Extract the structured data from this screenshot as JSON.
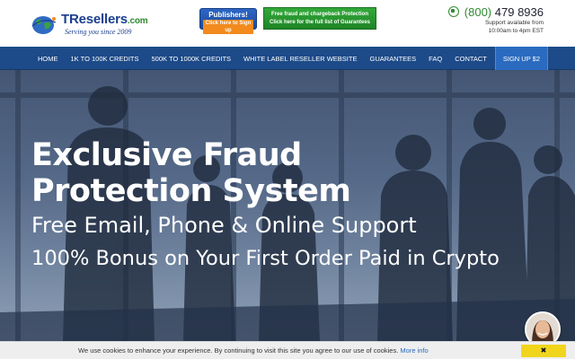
{
  "header": {
    "logo_name": "TResellers",
    "logo_tld": ".com",
    "tagline": "Serving you since 2009",
    "publishers_button": {
      "title": "Publishers!",
      "subtitle": "Click here to Sign up"
    },
    "fraud_button": {
      "line1": "Free fraud and chargeback Protection",
      "line2": "Click here for the full list of Guarantees"
    },
    "phone": {
      "area": "(800)",
      "number": "479 8936"
    },
    "support_line1": "Support available from",
    "support_line2": "10:00am to 4pm EST"
  },
  "nav": {
    "items": [
      {
        "label": "HOME"
      },
      {
        "label": "1K TO 100K CREDITS"
      },
      {
        "label": "500K TO 1000K CREDITS"
      },
      {
        "label": "WHITE LABEL RESELLER WEBSITE"
      },
      {
        "label": "GUARANTEES"
      },
      {
        "label": "FAQ"
      },
      {
        "label": "CONTACT"
      },
      {
        "label": "SIGN UP $2"
      }
    ]
  },
  "hero": {
    "title_line1": "Exclusive Fraud",
    "title_line2": "Protection System",
    "subtitle1": "Free Email, Phone & Online Support",
    "subtitle2": "100% Bonus on Your First Order Paid in Crypto"
  },
  "cookie": {
    "text": "We use cookies to enhance your experience. By continuing to visit this site you agree to our use of cookies.",
    "link": "More info",
    "close": "✖"
  },
  "colors": {
    "nav_bg": "#1d4a88",
    "signup_bg": "#2a6bc0",
    "brand_blue": "#1a3f8f",
    "brand_green": "#2f8a2f",
    "cookie_button": "#f1d51d"
  }
}
